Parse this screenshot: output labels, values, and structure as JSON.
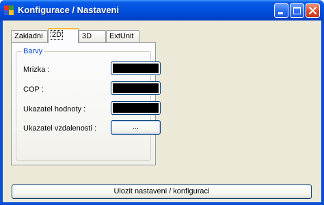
{
  "window": {
    "title": "Konfigurace / Nastaveni",
    "titlebar_color": "#0054e3",
    "icon": "app-window-icon",
    "controls": [
      "minimize-icon",
      "maximize-icon",
      "close-icon"
    ]
  },
  "tabs": [
    {
      "label": "Zakladni",
      "active": false
    },
    {
      "label": "2D",
      "active": true
    },
    {
      "label": "3D",
      "active": false
    },
    {
      "label": "ExtUnit",
      "active": false
    }
  ],
  "group": {
    "title": "Barvy",
    "title_color": "#0046d5",
    "rows": [
      {
        "label": "Mrizka :",
        "color": "#000000"
      },
      {
        "label": "COP :",
        "color": "#000000"
      },
      {
        "label": "Ukazatel hodnoty :",
        "color": "#000000"
      },
      {
        "label": "Ukazatel vzdalenosti :",
        "button": "..."
      }
    ]
  },
  "footer": {
    "save_label": "Ulozit nastaveni / konfiguraci"
  }
}
